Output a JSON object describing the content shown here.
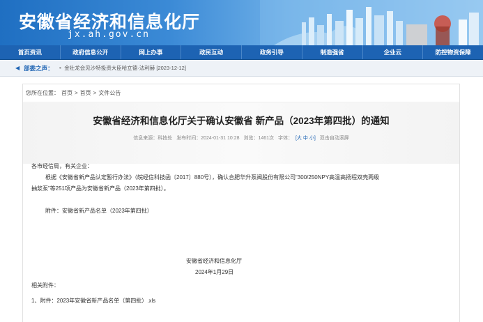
{
  "header": {
    "title": "安徽省经济和信息化厅",
    "domain": "jx.ah.gov.cn"
  },
  "nav": {
    "items": [
      "首页资讯",
      "政府信息公开",
      "网上办事",
      "政民互动",
      "政务引导",
      "制造强省",
      "企业云",
      "防控物资保障"
    ]
  },
  "ticker": {
    "label": "部委之声：",
    "item": "金壮龙会见沙特投资大臣哈立德·法利赫 [2023-12-12]"
  },
  "breadcrumb": {
    "prefix": "您所在位置：",
    "home": "首页",
    "sep1": ">",
    "page": "首页",
    "sep2": ">",
    "current": "文件公告"
  },
  "article": {
    "title": "安徽省经济和信息化厅关于确认安徽省 新产品（2023年第四批）的通知",
    "meta": {
      "source": "信息来源：科技处",
      "date": "发布时间：2024-01-31 10:28",
      "views": "浏览：1461次",
      "font": "字体：",
      "font_sizes": "[大 中 小]",
      "scroll": "双击自动滚屏"
    },
    "salutation": "各市经信局，有关企业：",
    "paragraph": "根据《安徽省新产品认定暂行办法》（皖经信科技函〔2017〕880号），确认合肥华升泵阀股份有限公司“300/250NPY高温高扬程双壳两级",
    "paragraph_cont": "抽浆泵”等251项产品为安徽省新产品（2023年第四批）。",
    "attachment": "附件：安徽省新产品名单（2023年第四批）",
    "signature": "安徽省经济和信息化厅",
    "sign_date": "2024年1月29日",
    "related_label": "相关附件：",
    "related_item": "1、附件：2023年安徽省新产品名单（第四批）.xls"
  }
}
